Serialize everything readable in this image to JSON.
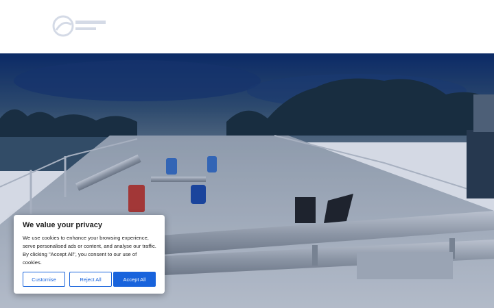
{
  "header": {
    "logo_icon": "company-logo-icon"
  },
  "hero": {
    "image": "tanker-ship-deck-photo",
    "overlay_color": "#0e2d6b"
  },
  "cookie": {
    "title": "We value your privacy",
    "body": "We use cookies to enhance your browsing experience, serve personalised ads or content, and analyse our traffic. By clicking \"Accept All\", you consent to our use of cookies.",
    "customise_label": "Customise",
    "reject_label": "Reject All",
    "accept_label": "Accept All",
    "accent_color": "#1863dc"
  }
}
